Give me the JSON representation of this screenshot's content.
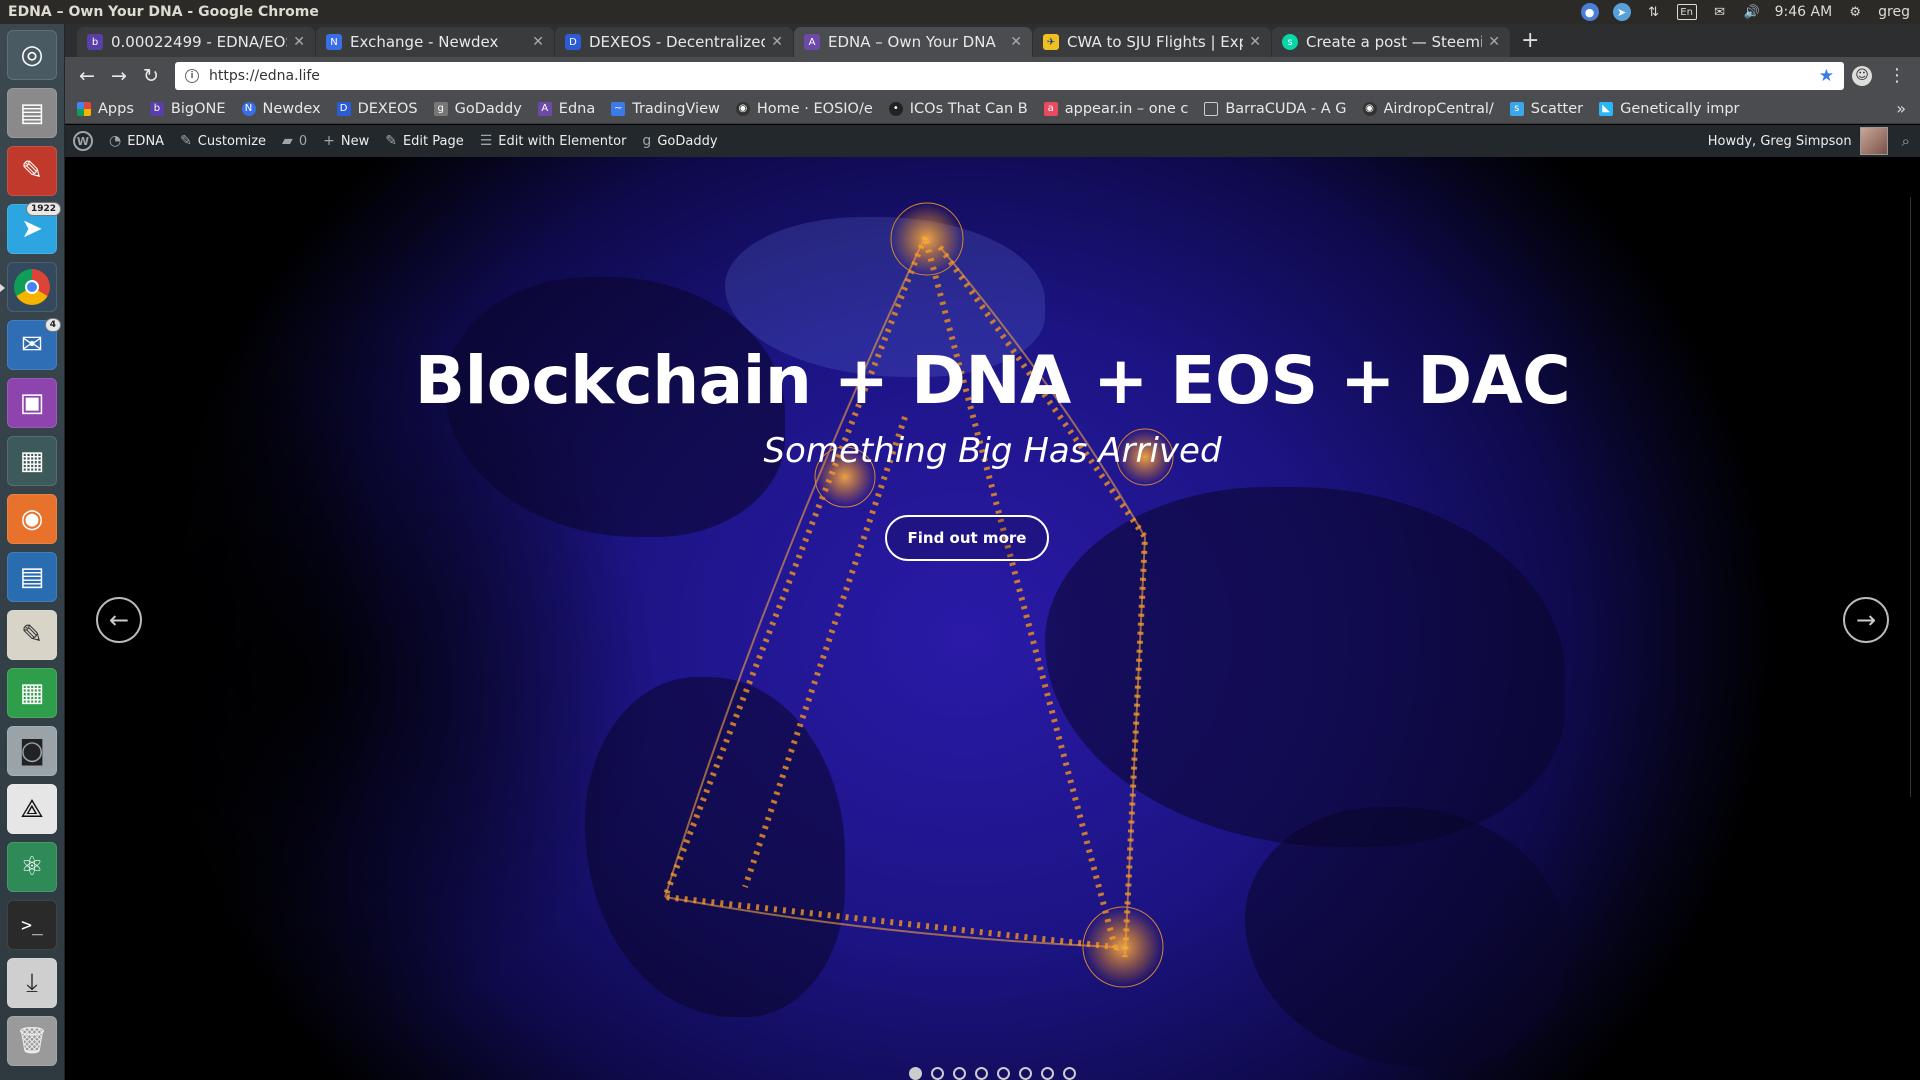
{
  "window": {
    "title": "EDNA – Own Your DNA - Google Chrome"
  },
  "tray": {
    "lang": "En",
    "time": "9:46 AM",
    "user": "greg"
  },
  "launcher": {
    "telegram_badge": "1922",
    "mail_badge": "4"
  },
  "tabs": [
    {
      "title": "0.00022499 - EDNA/EOS - ",
      "fav_color": "#5b3fa8"
    },
    {
      "title": "Exchange - Newdex",
      "fav_color": "#3a6ee8"
    },
    {
      "title": "DEXEOS - Decentralized E",
      "fav_color": "#2c5bd6"
    },
    {
      "title": "EDNA – Own Your DNA",
      "fav_color": "#6d4aa8"
    },
    {
      "title": "CWA to SJU Flights | Expe",
      "fav_color": "#f0c020"
    },
    {
      "title": "Create a post — Steemit",
      "fav_color": "#06d6a9"
    }
  ],
  "active_tab_index": 3,
  "omnibox": {
    "url": "https://edna.life"
  },
  "bookmarks": [
    {
      "label": "Apps",
      "icon": "apps-grid-icon",
      "color": "#e0463a"
    },
    {
      "label": "BigONE",
      "icon": "bigone-icon",
      "color": "#5b3fa8"
    },
    {
      "label": "Newdex",
      "icon": "newdex-icon",
      "color": "#3a6ee8"
    },
    {
      "label": "DEXEOS",
      "icon": "dexeos-icon",
      "color": "#2c5bd6"
    },
    {
      "label": "GoDaddy",
      "icon": "godaddy-icon",
      "color": "#777777"
    },
    {
      "label": "Edna",
      "icon": "edna-icon",
      "color": "#6d4aa8"
    },
    {
      "label": "TradingView",
      "icon": "tradingview-icon",
      "color": "#3a7be8"
    },
    {
      "label": "Home · EOSIO/e",
      "icon": "github-icon",
      "color": "#333333"
    },
    {
      "label": "ICOs That Can B",
      "icon": "dot-icon",
      "color": "#222222"
    },
    {
      "label": "appear.in – one c",
      "icon": "appearin-icon",
      "color": "#e84a5f"
    },
    {
      "label": "BarraCUDA - A G",
      "icon": "page-icon",
      "color": "#888888"
    },
    {
      "label": "AirdropCentral/",
      "icon": "github-icon",
      "color": "#333333"
    },
    {
      "label": "Scatter",
      "icon": "scatter-icon",
      "color": "#3ba7e8"
    },
    {
      "label": "Genetically impr",
      "icon": "triangle-icon",
      "color": "#29b6f6"
    }
  ],
  "wpbar": {
    "site": "EDNA",
    "customize": "Customize",
    "comments": "0",
    "new": "New",
    "edit_page": "Edit Page",
    "elementor": "Edit with Elementor",
    "godaddy": "GoDaddy",
    "howdy": "Howdy, Greg Simpson"
  },
  "hero": {
    "title": "Blockchain + DNA + EOS + DAC",
    "subtitle": "Something Big Has Arrived",
    "cta": "Find out more",
    "slide_count": 8,
    "active_slide": 0
  }
}
